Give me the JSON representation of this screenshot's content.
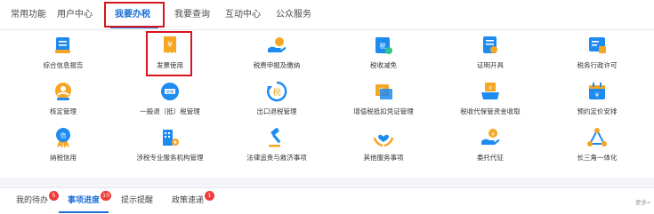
{
  "top_tabs": [
    {
      "label": "常用功能",
      "active": false
    },
    {
      "label": "用户中心",
      "active": false
    },
    {
      "label": "我要办税",
      "active": true
    },
    {
      "label": "我要查询",
      "active": false
    },
    {
      "label": "互动中心",
      "active": false
    },
    {
      "label": "公众服务",
      "active": false
    }
  ],
  "grid": [
    {
      "label": "综合信息报告",
      "icon": "report-document-icon",
      "color": "#1e8bf0"
    },
    {
      "label": "发票使用",
      "icon": "invoice-icon",
      "color": "#f5a623"
    },
    {
      "label": "税费申报及缴纳",
      "icon": "hand-payment-icon",
      "color": "#1e8bf0"
    },
    {
      "label": "税收减免",
      "icon": "tax-reduction-icon",
      "color": "#1e8bf0"
    },
    {
      "label": "证明开具",
      "icon": "certificate-icon",
      "color": "#1e8bf0"
    },
    {
      "label": "税务行政许可",
      "icon": "permit-icon",
      "color": "#1e8bf0"
    },
    {
      "label": "核定管理",
      "icon": "verification-user-icon",
      "color": "#f5a623"
    },
    {
      "label": "一般退（抵）税管理",
      "icon": "refund-icon",
      "color": "#1e8bf0"
    },
    {
      "label": "出口退税管理",
      "icon": "export-refund-icon",
      "color": "#1e8bf0"
    },
    {
      "label": "增值税抵扣凭证管理",
      "icon": "vat-deduction-icon",
      "color": "#f5a623"
    },
    {
      "label": "税收代保管资金收取",
      "icon": "custody-fund-icon",
      "color": "#1e8bf0"
    },
    {
      "label": "预约定价安排",
      "icon": "calendar-pricing-icon",
      "color": "#1e8bf0"
    },
    {
      "label": "纳税信用",
      "icon": "credit-medal-icon",
      "color": "#1e8bf0"
    },
    {
      "label": "涉税专业服务机构管理",
      "icon": "building-gear-icon",
      "color": "#1e8bf0"
    },
    {
      "label": "法律追责与救济事项",
      "icon": "gavel-icon",
      "color": "#1e8bf0"
    },
    {
      "label": "其他服务事项",
      "icon": "heart-hands-icon",
      "color": "#f5a623"
    },
    {
      "label": "委托代征",
      "icon": "hand-coin-icon",
      "color": "#1e8bf0"
    },
    {
      "label": "长三角一体化",
      "icon": "triangle-network-icon",
      "color": "#f5a623"
    }
  ],
  "bottom_tabs": [
    {
      "label": "我的待办",
      "badge": "5",
      "active": false
    },
    {
      "label": "事项进度",
      "badge": "10",
      "active": true
    },
    {
      "label": "提示提醒",
      "badge": "",
      "active": false
    },
    {
      "label": "政策速递",
      "badge": "1",
      "active": false
    }
  ],
  "more_label": "更多»"
}
